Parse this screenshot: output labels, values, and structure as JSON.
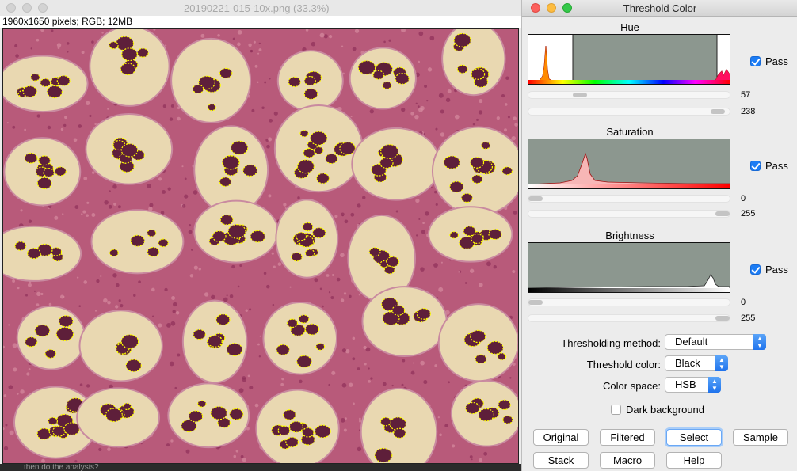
{
  "image_window": {
    "title": "20190221-015-10x.png (33.3%)",
    "info": "1960x1650 pixels; RGB; 12MB",
    "underlying_text": "then do the analysis?"
  },
  "dialog": {
    "title": "Threshold Color",
    "hue": {
      "label": "Hue",
      "min": "57",
      "max": "238",
      "pass_label": "Pass",
      "pass": true
    },
    "saturation": {
      "label": "Saturation",
      "min": "0",
      "max": "255",
      "pass_label": "Pass",
      "pass": true
    },
    "brightness": {
      "label": "Brightness",
      "min": "0",
      "max": "255",
      "pass_label": "Pass",
      "pass": true
    },
    "method_label": "Thresholding method:",
    "method_value": "Default",
    "color_label": "Threshold color:",
    "color_value": "Black",
    "space_label": "Color space:",
    "space_value": "HSB",
    "dark_bg_label": "Dark background",
    "dark_bg": false,
    "buttons": [
      "Original",
      "Filtered",
      "Select",
      "Sample",
      "Stack",
      "Macro",
      "Help"
    ]
  },
  "colors": {
    "background_tissue": "#e9d8b1",
    "stroma": "#b85a7a",
    "nuclei": "#5e1f3a",
    "threshold_overlay": "#ffff00",
    "hist_gray": "#8c978f",
    "accent": "#1c7cf4"
  }
}
